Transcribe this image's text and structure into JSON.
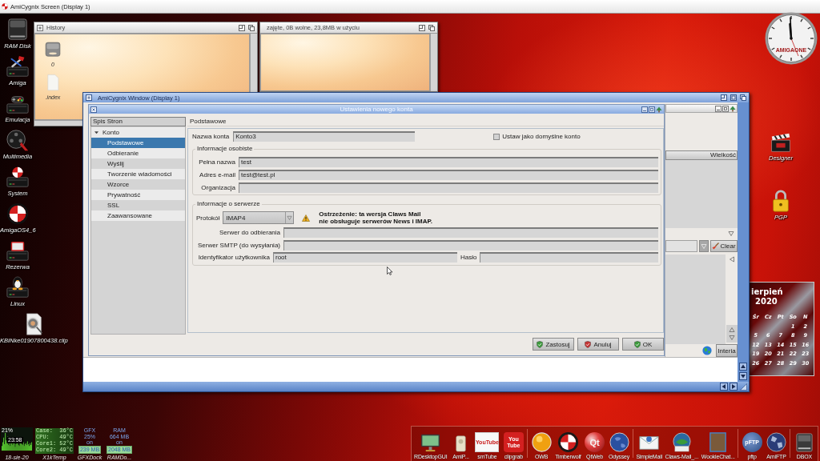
{
  "screen": {
    "title": "AmiCygnix Screen (Display 1)"
  },
  "desktop_icons": [
    {
      "label": "RAM Disk",
      "kind": "drive"
    },
    {
      "label": "Amiga",
      "kind": "tools"
    },
    {
      "label": "Emulacja",
      "kind": "gamepad"
    },
    {
      "label": "Multimedia",
      "kind": "film"
    },
    {
      "label": "System",
      "kind": "drawer_ball"
    },
    {
      "label": "AmigaOS4_6",
      "kind": "ball"
    },
    {
      "label": "Rezerwa",
      "kind": "drawer"
    },
    {
      "label": "Linux",
      "kind": "penguin"
    },
    {
      "label": "KBINke01907800438.clip",
      "kind": "clip"
    }
  ],
  "right_icons": [
    {
      "label": "Designer",
      "kind": "clapper"
    },
    {
      "label": "PGP",
      "kind": "lock"
    }
  ],
  "clock": {
    "brand": "AMIGAONE"
  },
  "history_window": {
    "title": "History",
    "items": [
      {
        "label": "0",
        "kind": "disk"
      },
      {
        "label": ".index",
        "kind": "file"
      }
    ]
  },
  "disk_window": {
    "title": "zajęte, 0B wolne, 23,8MB w użyciu"
  },
  "app_window": {
    "title": "AmiCygnix Window (Display 1)"
  },
  "dialog": {
    "title": "Ustawienia nowego konta",
    "sidebar": {
      "heading": "Spis Stron",
      "items": [
        {
          "label": "Konto",
          "expanded": true,
          "selected": false,
          "children": [
            {
              "label": "Podstawowe",
              "selected": true
            },
            {
              "label": "Odbieranie",
              "selected": false
            },
            {
              "label": "Wyślij",
              "selected": false
            },
            {
              "label": "Tworzenie wiadomości",
              "selected": false
            },
            {
              "label": "Wzorce",
              "selected": false
            },
            {
              "label": "Prywatność",
              "selected": false
            },
            {
              "label": "SSL",
              "selected": false
            },
            {
              "label": "Zaawansowane",
              "selected": false
            }
          ]
        }
      ]
    },
    "page_title": "Podstawowe",
    "account_name": {
      "label": "Nazwa konta",
      "value": "Konto3"
    },
    "default_account": {
      "label": "Ustaw jako domyślne konto",
      "checked": false
    },
    "personal": {
      "legend": "Informacje osobiste",
      "fields": [
        {
          "label": "Pełna nazwa",
          "value": "test"
        },
        {
          "label": "Adres e-mail",
          "value": "test@test.pl"
        },
        {
          "label": "Organizacja"
        }
      ]
    },
    "server": {
      "legend": "Informacje o serwerze",
      "protocol": {
        "label": "Protokół",
        "value": "IMAP4"
      },
      "warning": "Ostrzeżenie: ta wersja Claws Mail\nnie obsługuje serwerów News i IMAP.",
      "fields": [
        {
          "label": "Serwer do odbierania"
        },
        {
          "label": "Serwer SMTP (do wysyłania)"
        }
      ],
      "user": {
        "label": "Identyfikator użytkownika",
        "value": "root"
      },
      "password": {
        "label": "Hasło"
      }
    },
    "buttons": [
      {
        "label": "Zastosuj",
        "kind": "apply"
      },
      {
        "label": "Anuluj",
        "kind": "cancel"
      },
      {
        "label": "OK",
        "kind": "ok"
      }
    ]
  },
  "mail_window": {
    "column_header": "Wielkość",
    "clear_button": "Clear",
    "status_button": "Interia"
  },
  "calendar": {
    "month": "ierpień",
    "year": "2020",
    "weekdays": [
      "Śr",
      "Cz",
      "Pt",
      "So",
      "N"
    ],
    "weeks": [
      [
        "1",
        "2"
      ],
      [
        "5",
        "6",
        "7",
        "8",
        "9"
      ],
      [
        "12",
        "13",
        "14",
        "15",
        "16"
      ],
      [
        "19",
        "20",
        "21",
        "22",
        "23"
      ],
      [
        "26",
        "27",
        "28",
        "29",
        "30"
      ]
    ]
  },
  "system_monitor": {
    "cpu": "21%",
    "time": "23:58",
    "date": "18-sie-20"
  },
  "temperature": {
    "label": "X1kTemp",
    "rows": [
      {
        "name": "Case:",
        "value": "36°C"
      },
      {
        "name": "CPU:",
        "value": "49°C"
      },
      {
        "name": "Core1:",
        "value": "52°C"
      },
      {
        "name": "Core2:",
        "value": "49°C"
      }
    ]
  },
  "gfx_dock": {
    "label": "GFXDock",
    "lines": [
      "GFX",
      "25%",
      "on"
    ],
    "total": "239 MB"
  },
  "ram_dock": {
    "label": "RAMDo...",
    "lines": [
      "RAM",
      "664 MB",
      "on"
    ],
    "total": "2048 MB"
  },
  "dock": {
    "groups": [
      [
        {
          "label": "RDesktopGUI",
          "kind": "monitor"
        },
        {
          "label": "AmiP...",
          "kind": "device"
        },
        {
          "label": "smTube",
          "kind": "video",
          "glyph": "YouTube"
        },
        {
          "label": "clipgrab",
          "kind": "video_glass",
          "glyph": "You\nTube"
        }
      ],
      [
        {
          "label": "OWB",
          "kind": "orb"
        },
        {
          "label": "Timberwolf",
          "kind": "checker_ball"
        },
        {
          "label": "QtWeb",
          "kind": "qt",
          "glyph": "Qt"
        },
        {
          "label": "Odyssey",
          "kind": "globe"
        }
      ],
      [
        {
          "label": "SimpleMail",
          "kind": "envelope"
        },
        {
          "label": "Claws-Mail_...",
          "kind": "claws"
        },
        {
          "label": "WookieChat...",
          "kind": "portrait"
        }
      ],
      [
        {
          "label": "pftp",
          "kind": "pftp",
          "glyph": "pFTP"
        },
        {
          "label": "AmiFTP",
          "kind": "globe_dark"
        }
      ],
      [
        {
          "label": "DBOX",
          "kind": "drive"
        }
      ]
    ]
  }
}
